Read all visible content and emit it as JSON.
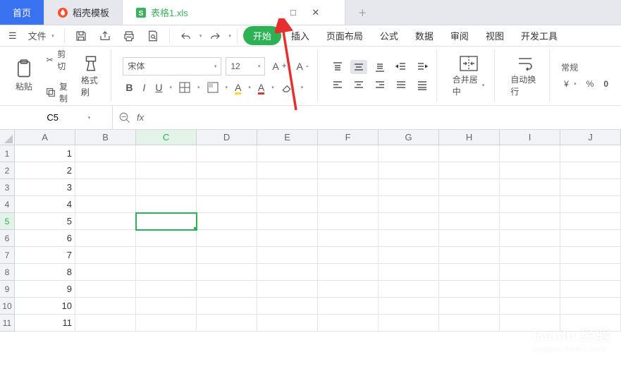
{
  "tabs": {
    "home": "首页",
    "dock": "稻壳模板",
    "sheet": "表格1.xls"
  },
  "menu": {
    "file": "文件",
    "start": "开始",
    "insert": "插入",
    "layout": "页面布局",
    "formula": "公式",
    "data": "数据",
    "review": "审阅",
    "view": "视图",
    "dev": "开发工具"
  },
  "tool": {
    "paste": "粘贴",
    "cut": "剪切",
    "copy": "复制",
    "fmt": "格式刷",
    "font": "宋体",
    "size": "12",
    "merge": "合并居中",
    "wrap": "自动换行",
    "numfmt": "常规"
  },
  "fbar": {
    "cell": "C5",
    "fx": "fx"
  },
  "cols": [
    "A",
    "B",
    "C",
    "D",
    "E",
    "F",
    "G",
    "H",
    "I",
    "J"
  ],
  "rows": [
    {
      "n": "1",
      "a": "1"
    },
    {
      "n": "2",
      "a": "2"
    },
    {
      "n": "3",
      "a": "3"
    },
    {
      "n": "4",
      "a": "4"
    },
    {
      "n": "5",
      "a": "5"
    },
    {
      "n": "6",
      "a": "6"
    },
    {
      "n": "7",
      "a": "7"
    },
    {
      "n": "8",
      "a": "8"
    },
    {
      "n": "9",
      "a": "9"
    },
    {
      "n": "10",
      "a": "10"
    },
    {
      "n": "11",
      "a": "11"
    }
  ],
  "sel": {
    "row": 4,
    "col": 2
  },
  "watermark": {
    "brand": "Baidu 经验",
    "sub": "jingyan.baidu.com"
  }
}
